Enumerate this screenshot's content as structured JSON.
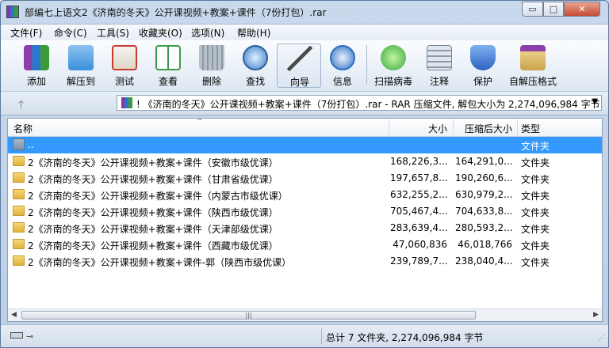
{
  "window": {
    "title": "部编七上语文2《济南的冬天》公开课视频+教案+课件（7份打包）.rar",
    "controls": {
      "minimize": "▭",
      "maximize": "□",
      "close": "✕"
    }
  },
  "menu": [
    {
      "label": "文件(F)"
    },
    {
      "label": "命令(C)"
    },
    {
      "label": "工具(S)"
    },
    {
      "label": "收藏夹(O)"
    },
    {
      "label": "选项(N)"
    },
    {
      "label": "帮助(H)"
    }
  ],
  "toolbar": [
    {
      "label": "添加",
      "icon": "add-icon",
      "color": "#8b3fa8"
    },
    {
      "label": "解压到",
      "icon": "extract-folder-icon",
      "color": "#3a8fdc"
    },
    {
      "label": "测试",
      "icon": "test-clipboard-icon",
      "color": "#c83a2a"
    },
    {
      "label": "查看",
      "icon": "view-book-icon",
      "color": "#3b9b4a"
    },
    {
      "label": "删除",
      "icon": "trash-icon",
      "color": "#8c98a6"
    },
    {
      "label": "查找",
      "icon": "search-magnifier-icon",
      "color": "#3b7fc9"
    },
    {
      "label": "向导",
      "icon": "wizard-wand-icon",
      "color": "#6a8fb8"
    },
    {
      "label": "信息",
      "icon": "info-icon",
      "color": "#2f6fc0"
    },
    {
      "label": "扫描病毒",
      "icon": "virus-scan-icon",
      "color": "#3aa83a"
    },
    {
      "label": "注释",
      "icon": "comment-icon",
      "color": "#8d9bab"
    },
    {
      "label": "保护",
      "icon": "shield-icon",
      "color": "#2c63c2"
    },
    {
      "label": "自解压格式",
      "icon": "sfx-box-icon",
      "color": "#c9a24a"
    }
  ],
  "address": {
    "text": "! 《济南的冬天》公开课视频+教案+课件（7份打包）.rar - RAR 压缩文件, 解包大小为 2,274,096,984 字节"
  },
  "columns": {
    "name": "名称",
    "size": "大小",
    "packed": "压缩后大小",
    "type": "类型"
  },
  "rows": [
    {
      "name": "..",
      "size": "",
      "packed": "",
      "type": "文件夹",
      "selected": true,
      "icon": "up-folder-icon"
    },
    {
      "name": "2《济南的冬天》公开课视频+教案+课件（安徽市级优课）",
      "size": "168,226,3...",
      "packed": "164,291,0...",
      "type": "文件夹",
      "selected": false,
      "icon": "folder-icon"
    },
    {
      "name": "2《济南的冬天》公开课视频+教案+课件（甘肃省级优课）",
      "size": "197,657,8...",
      "packed": "190,260,6...",
      "type": "文件夹",
      "selected": false,
      "icon": "folder-icon"
    },
    {
      "name": "2《济南的冬天》公开课视频+教案+课件（内蒙古市级优课）",
      "size": "632,255,2...",
      "packed": "630,979,2...",
      "type": "文件夹",
      "selected": false,
      "icon": "folder-icon"
    },
    {
      "name": "2《济南的冬天》公开课视频+教案+课件（陕西市级优课）",
      "size": "705,467,4...",
      "packed": "704,633,8...",
      "type": "文件夹",
      "selected": false,
      "icon": "folder-icon"
    },
    {
      "name": "2《济南的冬天》公开课视频+教案+课件（天津部级优课）",
      "size": "283,639,4...",
      "packed": "280,593,2...",
      "type": "文件夹",
      "selected": false,
      "icon": "folder-icon"
    },
    {
      "name": "2《济南的冬天》公开课视频+教案+课件（西藏市级优课）",
      "size": "47,060,836",
      "packed": "46,018,766",
      "type": "文件夹",
      "selected": false,
      "icon": "folder-icon"
    },
    {
      "name": "2《济南的冬天》公开课视频+教案+课件-郭（陕西市级优课）",
      "size": "239,789,7...",
      "packed": "238,040,4...",
      "type": "文件夹",
      "selected": false,
      "icon": "folder-icon"
    }
  ],
  "scrollbar": {
    "thumb_grip": "|||"
  },
  "status": {
    "text": "总计 7 文件夹, 2,274,096,984 字节"
  }
}
